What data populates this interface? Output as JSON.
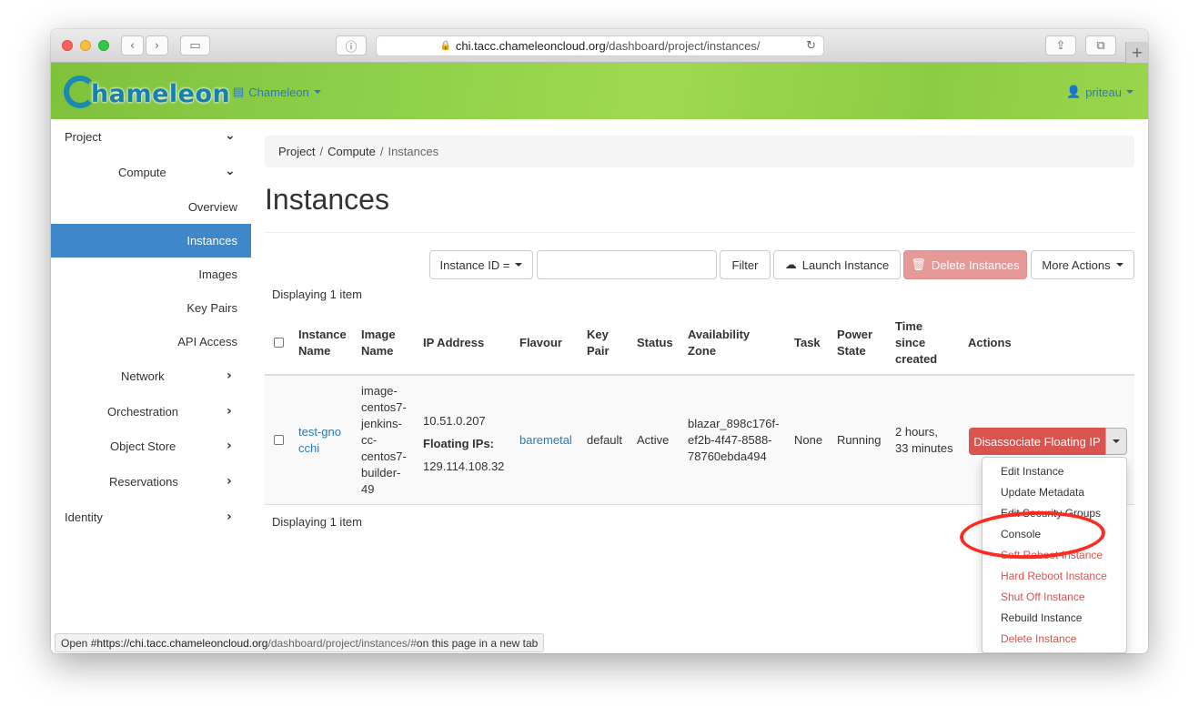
{
  "browser": {
    "url_host": "chi.tacc.chameleoncloud.org",
    "url_path": "/dashboard/project/instances/",
    "icons": [
      "back-icon",
      "forward-icon",
      "sidebar-icon",
      "reader-icon",
      "lock-icon",
      "reload-icon",
      "share-icon",
      "tabs-icon",
      "new-tab-icon"
    ]
  },
  "header": {
    "logo_text": "hameleon",
    "project_switch": "Chameleon",
    "user": "priteau",
    "colors": {
      "bar": "#8ed04a",
      "link": "#2f7ab5",
      "logo": "#1a7faa"
    }
  },
  "sidebar": {
    "project": "Project",
    "compute": "Compute",
    "overview": "Overview",
    "instances": "Instances",
    "images": "Images",
    "key_pairs": "Key Pairs",
    "api_access": "API Access",
    "network": "Network",
    "orchestration": "Orchestration",
    "object_store": "Object Store",
    "reservations": "Reservations",
    "identity": "Identity",
    "active_color": "#3e87c8"
  },
  "breadcrumb": {
    "project": "Project",
    "compute": "Compute",
    "current": "Instances",
    "sep": "/"
  },
  "page_title": "Instances",
  "toolbar": {
    "filter_field": "Instance ID =",
    "search_value": "",
    "filter_button": "Filter",
    "launch_button": "Launch Instance",
    "delete_button": "Delete Instances",
    "more_actions": "More Actions"
  },
  "displaying": "Displaying 1 item",
  "table": {
    "headers": {
      "instance_name": [
        "Instance",
        "Name"
      ],
      "image_name": [
        "Image",
        "Name"
      ],
      "ip_address": "IP Address",
      "flavour": "Flavour",
      "key_pair": [
        "Key",
        "Pair"
      ],
      "status": "Status",
      "availability_zone": [
        "Availability",
        "Zone"
      ],
      "task": "Task",
      "power_state": [
        "Power",
        "State"
      ],
      "time_since_created": [
        "Time",
        "since",
        "created"
      ],
      "actions": "Actions"
    },
    "row": {
      "instance_name": [
        "test-gno",
        "cchi"
      ],
      "image_name": [
        "image-",
        "centos7-",
        "jenkins-",
        "cc-",
        "centos7-",
        "builder-",
        "49"
      ],
      "ip": "10.51.0.207",
      "floating_label": "Floating IPs:",
      "floating_ip": "129.114.108.32",
      "flavour": "baremetal",
      "key_pair": "default",
      "status": "Active",
      "availability_zone": [
        "blazar_898c176f-",
        "ef2b-4f47-8588-",
        "78760ebda494"
      ],
      "task": "None",
      "power_state": "Running",
      "time_since_created": [
        "2 hours,",
        "33 minutes"
      ],
      "action_button": "Disassociate Floating IP"
    }
  },
  "actions_menu": {
    "items": [
      {
        "label": "Edit Instance",
        "danger": false
      },
      {
        "label": "Update Metadata",
        "danger": false
      },
      {
        "label": "Edit Security Groups",
        "danger": false
      },
      {
        "label": "Console",
        "danger": false
      },
      {
        "label": "Soft Reboot Instance",
        "danger": true
      },
      {
        "label": "Hard Reboot Instance",
        "danger": true
      },
      {
        "label": "Shut Off Instance",
        "danger": true
      },
      {
        "label": "Rebuild Instance",
        "danger": false
      },
      {
        "label": "Delete Instance",
        "danger": true
      }
    ],
    "danger_color": "#d9534f",
    "highlight_color": "#ff2a1f"
  },
  "statusbar": {
    "prefix": "Open #",
    "host": "https://chi.tacc.chameleoncloud.org",
    "path": "/dashboard/project/instances/#",
    "suffix": " on this page in a new tab"
  }
}
